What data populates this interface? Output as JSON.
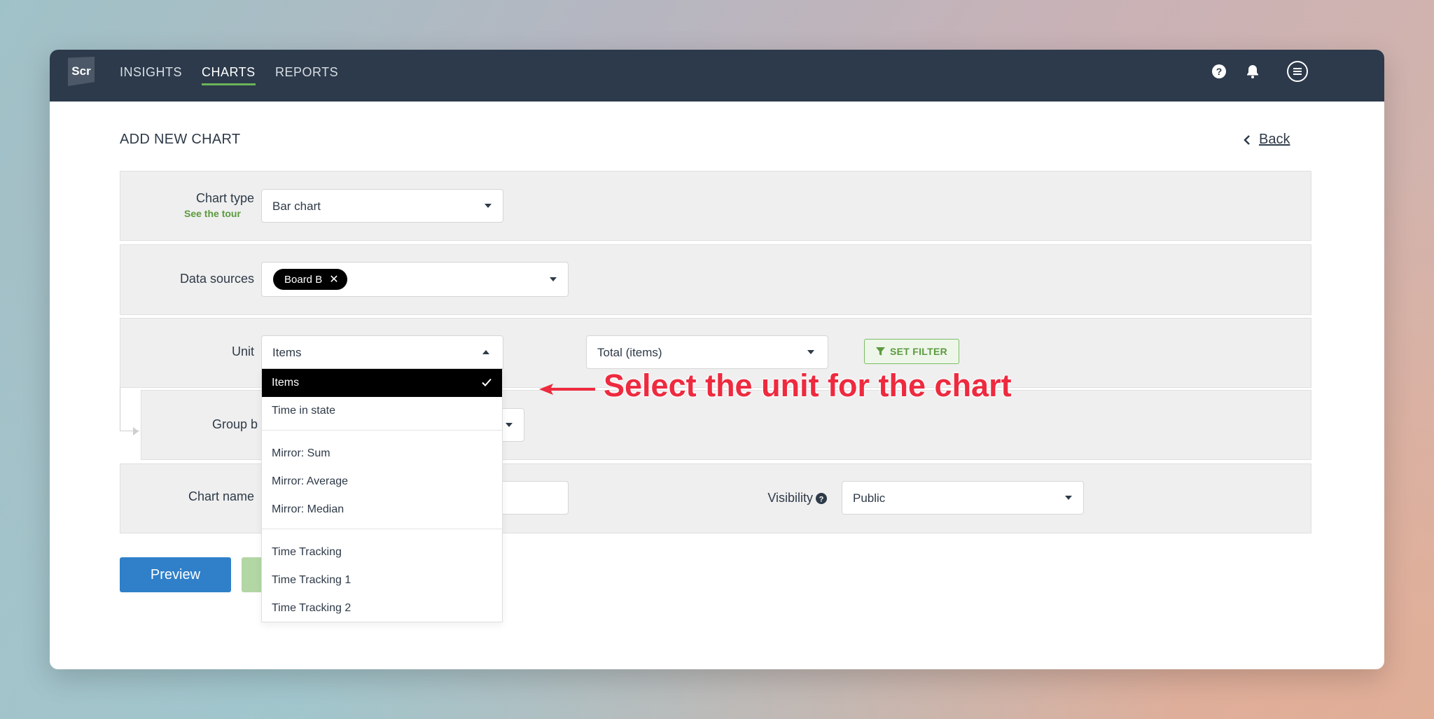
{
  "app": {
    "logo_text": "Scr"
  },
  "nav": {
    "items": [
      {
        "label": "INSIGHTS",
        "active": false
      },
      {
        "label": "CHARTS",
        "active": true
      },
      {
        "label": "REPORTS",
        "active": false
      }
    ],
    "icons": [
      "help-icon",
      "bell-icon",
      "menu-icon"
    ],
    "active_underline_color": "#6cb35a"
  },
  "page": {
    "title": "ADD NEW CHART",
    "back_label": "Back"
  },
  "form": {
    "chart_type": {
      "label": "Chart type",
      "tour_link": "See the tour",
      "value": "Bar chart"
    },
    "data_sources": {
      "label": "Data sources",
      "chips": [
        "Board B"
      ]
    },
    "unit": {
      "label": "Unit",
      "value": "Items",
      "aggregate_value": "Total (items)",
      "filter_button": "SET FILTER"
    },
    "group_by": {
      "label": "Group b"
    },
    "chart_name": {
      "label": "Chart name",
      "value": ""
    },
    "visibility": {
      "label": "Visibility",
      "value": "Public"
    }
  },
  "unit_dropdown": {
    "groups": [
      [
        "Items",
        "Time in state"
      ],
      [
        "Mirror: Sum",
        "Mirror: Average",
        "Mirror: Median"
      ],
      [
        "Time Tracking",
        "Time Tracking 1",
        "Time Tracking 2"
      ]
    ],
    "selected": "Items"
  },
  "buttons": {
    "preview": "Preview"
  },
  "annotation": {
    "text": "Select the unit for the chart",
    "color": "#ee2a3f"
  },
  "colors": {
    "topbar": "#2c3a4b",
    "primary": "#2f80c9",
    "accent_green": "#5b9a3d"
  }
}
